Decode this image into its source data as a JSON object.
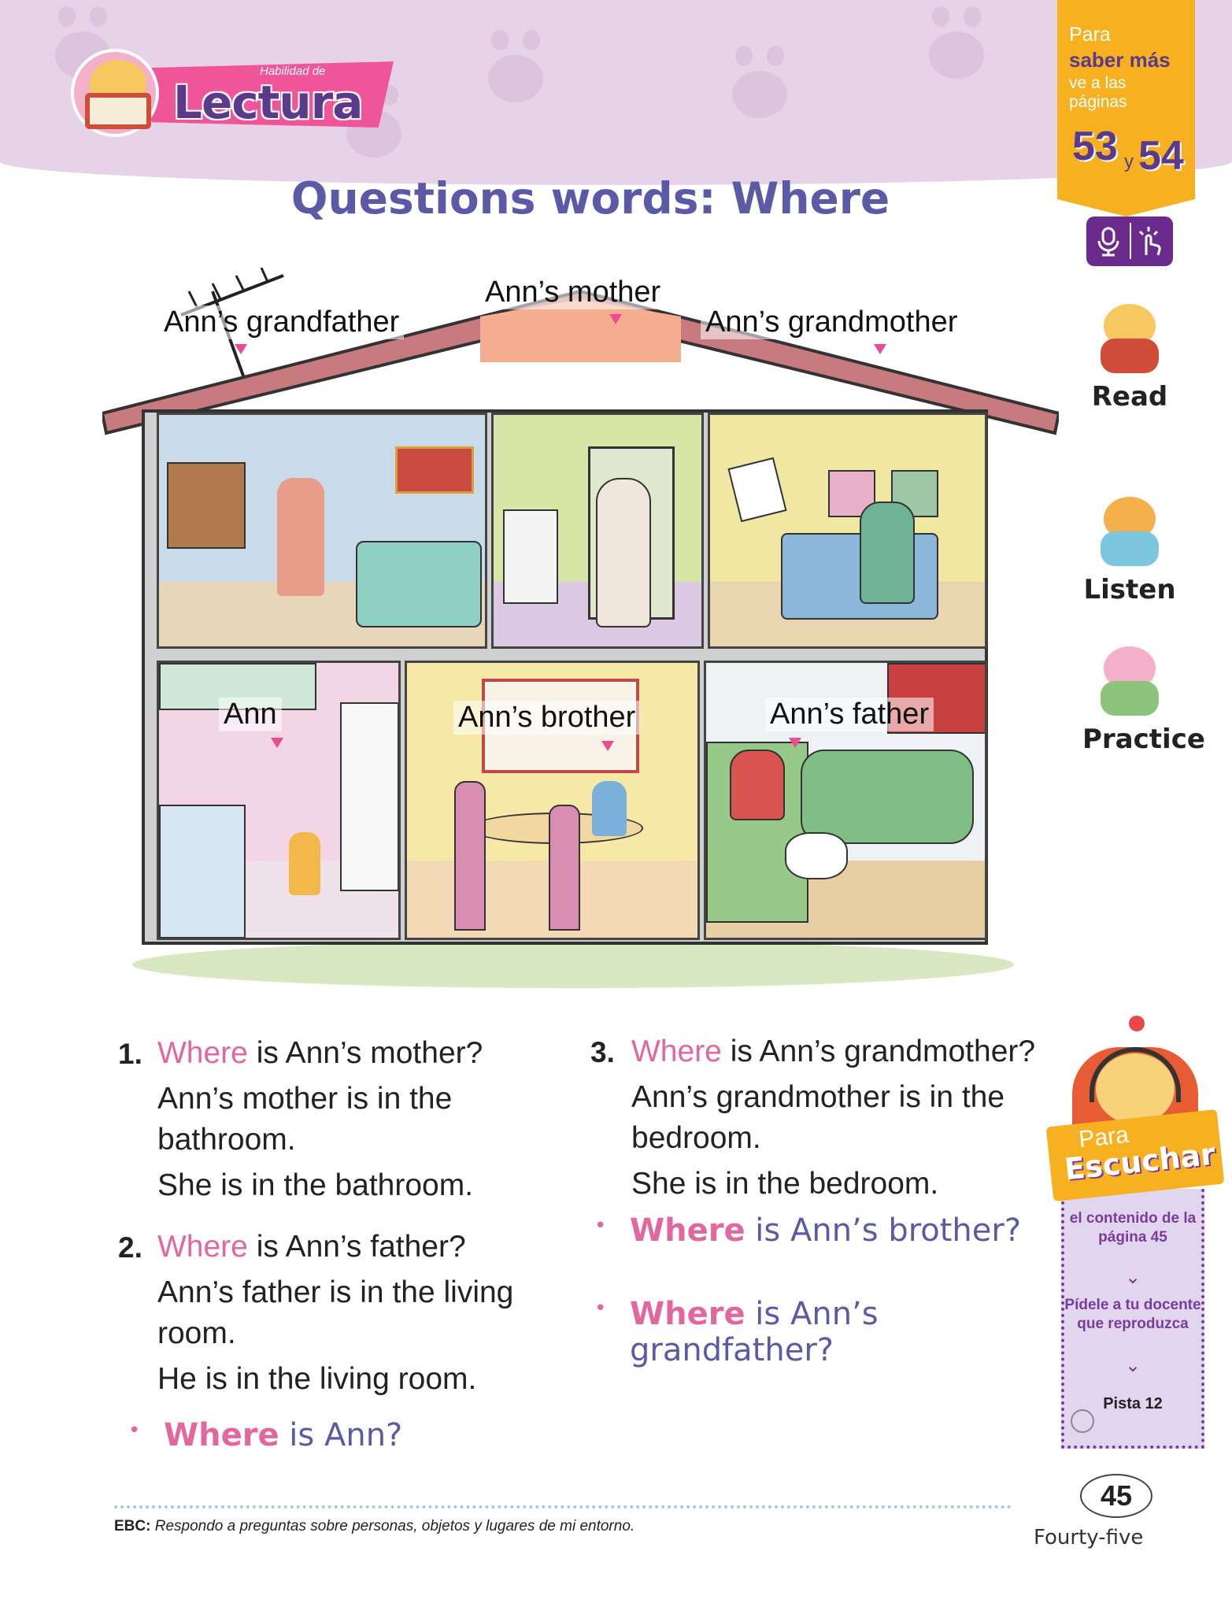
{
  "header": {
    "section_sub": "Habilidad de",
    "section_title": "Lectura",
    "page_title": "Questions words: Where"
  },
  "reference": {
    "line1": "Para",
    "line2": "saber más",
    "line3": "ve a las páginas",
    "page_a": "53",
    "joiner": "y",
    "page_b": "54"
  },
  "tools": {
    "audio_icon": "microphone-icon",
    "touch_icon": "touch-hand-icon"
  },
  "house": {
    "rooms": [
      {
        "id": "study",
        "label": "Ann’s grandfather"
      },
      {
        "id": "bathroom",
        "label": "Ann’s mother"
      },
      {
        "id": "bedroom",
        "label": "Ann’s grandmother"
      },
      {
        "id": "kitchen",
        "label": "Ann"
      },
      {
        "id": "dining",
        "label": "Ann’s brother"
      },
      {
        "id": "living",
        "label": "Ann’s father"
      }
    ]
  },
  "side_nav": [
    {
      "label": "Read",
      "icon": "reading-bear-icon"
    },
    {
      "label": "Listen",
      "icon": "listening-bear-icon"
    },
    {
      "label": "Practice",
      "icon": "practice-bears-icon"
    }
  ],
  "questions": [
    {
      "number": "1.",
      "where": "Where",
      "rest": " is Ann’s mother?",
      "answer_line1": "Ann’s mother is in the",
      "answer_line2": "bathroom.",
      "short": "She is in the bathroom."
    },
    {
      "number": "2.",
      "where": "Where",
      "rest": " is Ann’s father?",
      "answer_line1": "Ann’s father is in the living",
      "answer_line2": "room.",
      "short": "He is in the living room."
    },
    {
      "number": "3.",
      "where": "Where",
      "rest": " is Ann’s grandmother?",
      "answer_line1": "Ann’s grandmother is in the",
      "answer_line2": "bedroom.",
      "short": "She is in the bedroom."
    }
  ],
  "practice_prompts": [
    {
      "where": "Where",
      "rest": " is Ann?"
    },
    {
      "where": "Where",
      "rest": " is Ann’s brother?"
    },
    {
      "where": "Where",
      "rest_line1": " is Ann’s",
      "rest_line2": "grandfather?"
    }
  ],
  "listen": {
    "para": "Para",
    "title": "Escuchar",
    "text1": "el contenido de la página 45",
    "text2": "Pídele a tu docente que reproduzca",
    "track": "Pista 12"
  },
  "footer": {
    "ebc_label": "EBC:",
    "ebc_text": "Respondo a preguntas sobre personas, objetos y lugares de mi entorno.",
    "page_number": "45",
    "page_word": "Fourty-five"
  },
  "colors": {
    "header_band": "#e7d3e8",
    "accent_pink": "#e2679e",
    "accent_purple": "#5b5aa6",
    "tag_orange": "#f7b120",
    "roof": "#c87b7e"
  }
}
